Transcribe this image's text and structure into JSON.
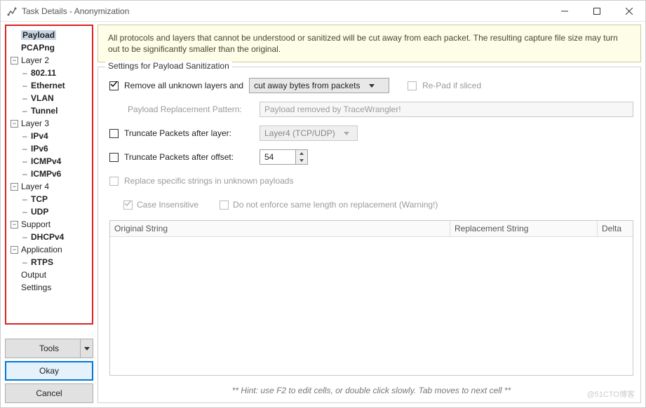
{
  "window": {
    "title": "Task Details - Anonymization"
  },
  "tree": {
    "items": [
      {
        "label": "Payload",
        "bold": true,
        "depth": 0,
        "leaf": true,
        "selected": true
      },
      {
        "label": "PCAPng",
        "bold": true,
        "depth": 0,
        "leaf": true
      },
      {
        "label": "Layer 2",
        "bold": false,
        "depth": 0,
        "expandable": true
      },
      {
        "label": "802.11",
        "bold": true,
        "depth": 1,
        "leaf": true
      },
      {
        "label": "Ethernet",
        "bold": true,
        "depth": 1,
        "leaf": true
      },
      {
        "label": "VLAN",
        "bold": true,
        "depth": 1,
        "leaf": true
      },
      {
        "label": "Tunnel",
        "bold": true,
        "depth": 1,
        "leaf": true
      },
      {
        "label": "Layer 3",
        "bold": false,
        "depth": 0,
        "expandable": true
      },
      {
        "label": "IPv4",
        "bold": true,
        "depth": 1,
        "leaf": true
      },
      {
        "label": "IPv6",
        "bold": true,
        "depth": 1,
        "leaf": true
      },
      {
        "label": "ICMPv4",
        "bold": true,
        "depth": 1,
        "leaf": true
      },
      {
        "label": "ICMPv6",
        "bold": true,
        "depth": 1,
        "leaf": true
      },
      {
        "label": "Layer 4",
        "bold": false,
        "depth": 0,
        "expandable": true
      },
      {
        "label": "TCP",
        "bold": true,
        "depth": 1,
        "leaf": true
      },
      {
        "label": "UDP",
        "bold": true,
        "depth": 1,
        "leaf": true
      },
      {
        "label": "Support",
        "bold": false,
        "depth": 0,
        "expandable": true
      },
      {
        "label": "DHCPv4",
        "bold": true,
        "depth": 1,
        "leaf": true
      },
      {
        "label": "Application",
        "bold": false,
        "depth": 0,
        "expandable": true
      },
      {
        "label": "RTPS",
        "bold": true,
        "depth": 1,
        "leaf": true
      },
      {
        "label": "Output",
        "bold": false,
        "depth": 0,
        "leaf": true
      },
      {
        "label": "Settings",
        "bold": false,
        "depth": 0,
        "leaf": true
      }
    ]
  },
  "buttons": {
    "tools": "Tools",
    "okay": "Okay",
    "cancel": "Cancel"
  },
  "info": "All protocols and layers that cannot be understood or sanitized will be cut away from each packet. The resulting capture file size may turn out to be significantly smaller than the original.",
  "group": {
    "legend": "Settings for Payload Sanitization",
    "remove_unknown": {
      "checked": true,
      "label": "Remove all unknown layers and",
      "combo": "cut away bytes from packets",
      "repad": "Re-Pad if sliced",
      "repad_checked": false
    },
    "pattern": {
      "label": "Payload Replacement Pattern:",
      "value": "Payload removed by TraceWrangler!"
    },
    "trunc_layer": {
      "checked": false,
      "label": "Truncate Packets after layer:",
      "combo": "Layer4 (TCP/UDP)"
    },
    "trunc_offset": {
      "checked": false,
      "label": "Truncate Packets after offset:",
      "value": "54"
    },
    "replace": {
      "checked": false,
      "label": "Replace specific strings in unknown payloads"
    },
    "case_insensitive": {
      "checked": true,
      "label": "Case Insensitive"
    },
    "no_enforce": {
      "checked": false,
      "label": "Do not enforce same length on replacement (Warning!)"
    },
    "table": {
      "col1": "Original String",
      "col2": "Replacement String",
      "col3": "Delta"
    },
    "hint": "** Hint: use F2 to edit cells, or double click slowly. Tab moves to next cell **"
  },
  "watermark": "@51CTO博客"
}
